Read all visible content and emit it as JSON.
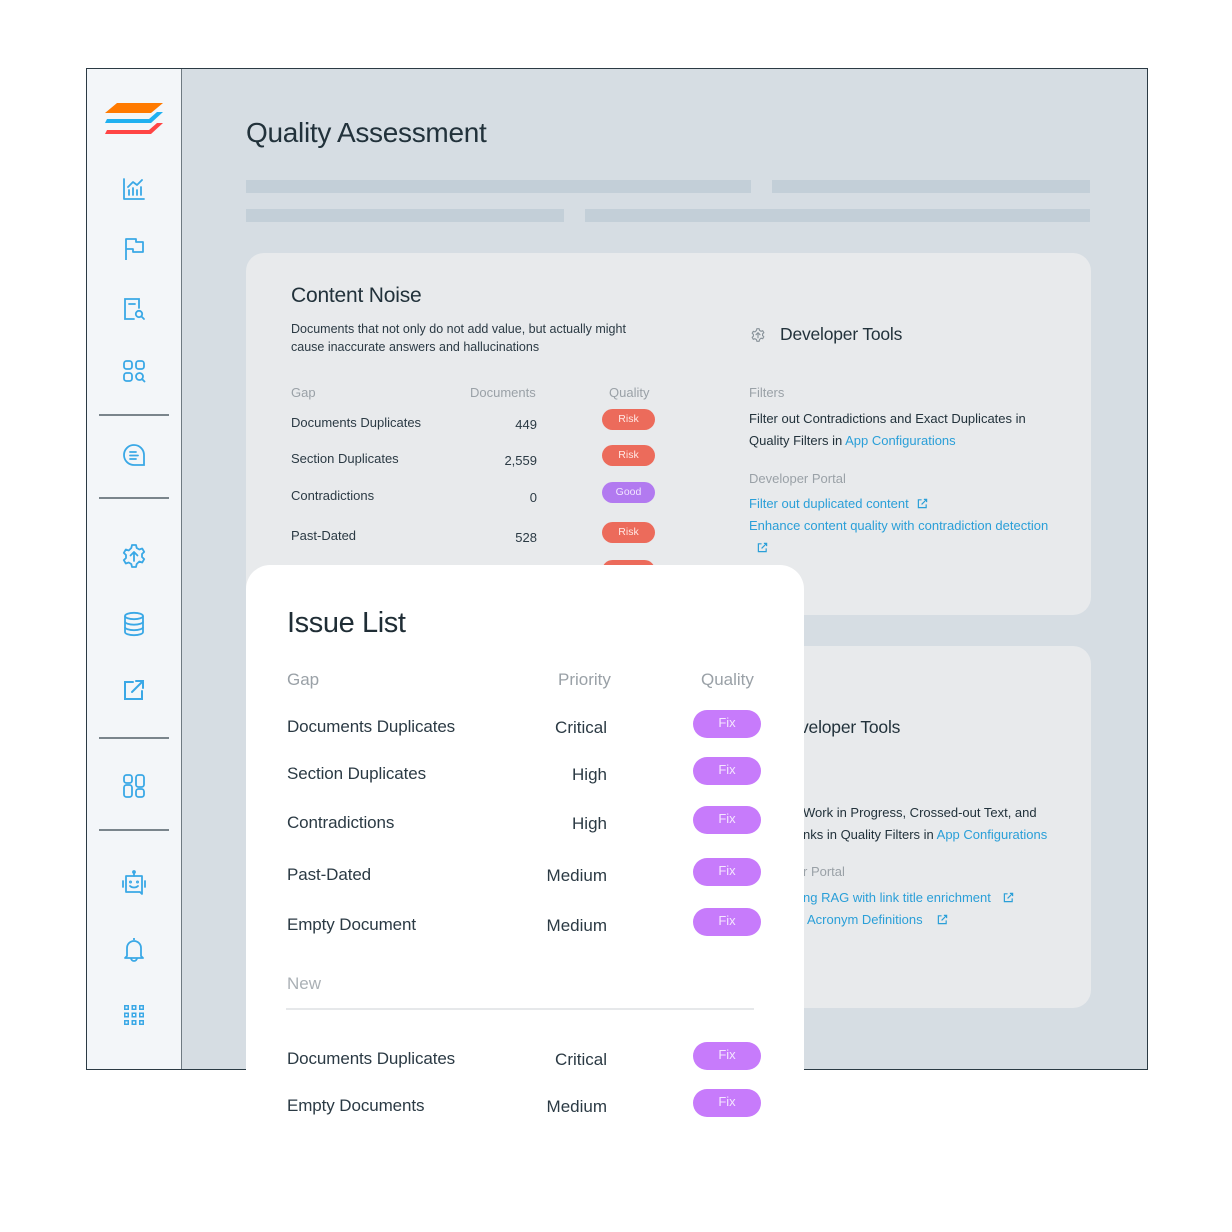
{
  "page": {
    "title": "Quality Assessment"
  },
  "sidebar": {
    "items": [
      {
        "icon": "analytics-chart-icon"
      },
      {
        "icon": "flag-icon"
      },
      {
        "icon": "document-search-icon"
      },
      {
        "icon": "grid-search-icon"
      },
      {
        "icon": "chat-bubble-icon"
      },
      {
        "icon": "gear-upload-icon"
      },
      {
        "icon": "database-icon"
      },
      {
        "icon": "external-link-icon"
      },
      {
        "icon": "dashboard-icon"
      },
      {
        "icon": "bot-icon"
      },
      {
        "icon": "bell-icon"
      },
      {
        "icon": "apps-grid-icon"
      }
    ]
  },
  "colors": {
    "accent": "#3aa8e6",
    "risk": "#ec6b5b",
    "good": "#b27af0",
    "fix": "#c77bfb",
    "link": "#2a9fd8"
  },
  "content_noise": {
    "title": "Content Noise",
    "description": "Documents that not only do not add value, but actually might cause inaccurate answers and hallucinations",
    "columns": {
      "gap": "Gap",
      "documents": "Documents",
      "quality": "Quality"
    },
    "rows": [
      {
        "gap": "Documents Duplicates",
        "documents": "449",
        "quality": "Risk"
      },
      {
        "gap": "Section Duplicates",
        "documents": "2,559",
        "quality": "Risk"
      },
      {
        "gap": "Contradictions",
        "documents": "0",
        "quality": "Good"
      },
      {
        "gap": "Past-Dated",
        "documents": "528",
        "quality": "Risk"
      }
    ]
  },
  "developer_tools": {
    "title": "Developer Tools",
    "filters_label": "Filters",
    "filters_text": "Filter out Contradictions and Exact Duplicates in Quality Filters in ",
    "filters_link": "App Configurations",
    "portal_label": "Developer Portal",
    "portal_links": [
      "Filter out duplicated content",
      "Enhance content quality with contradiction detection"
    ]
  },
  "developer_tools_2": {
    "title": "veloper Tools",
    "filters_text_1": "Work in Progress, Crossed-out Text, and",
    "filters_text_2": "nks in Quality Filters in ",
    "filters_link": "App Configurations",
    "portal_label": "r Portal",
    "portal_links": [
      "ng RAG with link title enrichment",
      "Acronym Definitions"
    ]
  },
  "issue_list": {
    "title": "Issue List",
    "columns": {
      "gap": "Gap",
      "priority": "Priority",
      "quality": "Quality"
    },
    "rows": [
      {
        "gap": "Documents Duplicates",
        "priority": "Critical",
        "action": "Fix"
      },
      {
        "gap": "Section Duplicates",
        "priority": "High",
        "action": "Fix"
      },
      {
        "gap": "Contradictions",
        "priority": "High",
        "action": "Fix"
      },
      {
        "gap": "Past-Dated",
        "priority": "Medium",
        "action": "Fix"
      },
      {
        "gap": "Empty Document",
        "priority": "Medium",
        "action": "Fix"
      }
    ],
    "new_section_label": "New",
    "new_rows": [
      {
        "gap": "Documents Duplicates",
        "priority": "Critical",
        "action": "Fix"
      },
      {
        "gap": "Empty Documents",
        "priority": "Medium",
        "action": "Fix"
      }
    ]
  }
}
